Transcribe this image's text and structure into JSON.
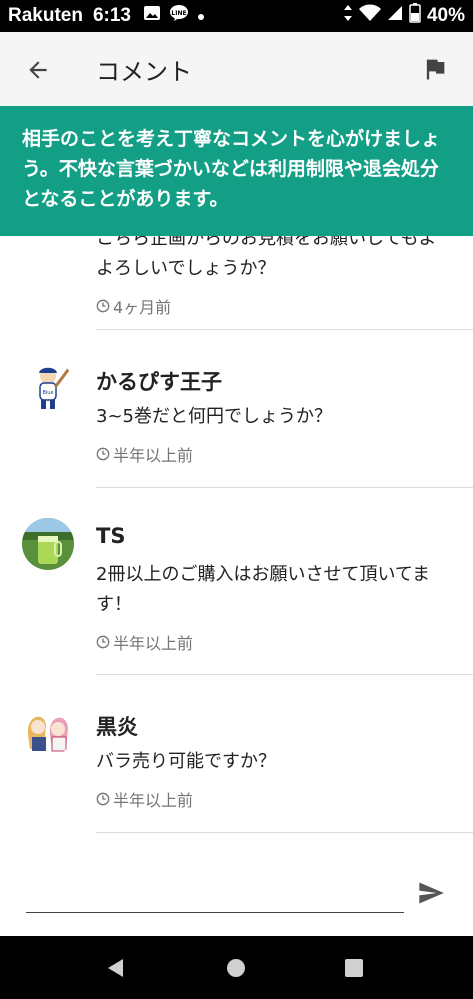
{
  "status_bar": {
    "carrier": "Rakuten",
    "time": "6:13",
    "battery": "40%",
    "icons": [
      "image-icon",
      "line-app-icon",
      "dot-icon",
      "data-arrows-icon",
      "wifi-icon",
      "signal-icon",
      "battery-icon"
    ]
  },
  "app_bar": {
    "title": "コメント",
    "back_icon": "arrow-back-icon",
    "report_icon": "flag-icon"
  },
  "banner": {
    "text": "相手のことを考え丁寧なコメントを心がけましょう。不快な言葉づかいなどは利用制限や退会処分となることがあります。"
  },
  "comments": [
    {
      "name": "",
      "text_partial_hidden": "こちら企画からのお見積をお願いしてもよ",
      "text_visible": "よろしいでしょうか？",
      "time": "4ヶ月前"
    },
    {
      "name": "かるぴす王子",
      "text": "3~5巻だと何円でしょうか？",
      "time": "半年以上前"
    },
    {
      "name": "TS",
      "text": "2冊以上のご購入はお願いさせて頂いてます！",
      "time": "半年以上前"
    },
    {
      "name": "黒炎",
      "text": "バラ売り可能ですか？",
      "time": "半年以上前"
    }
  ],
  "input": {
    "value": "",
    "placeholder": "",
    "send_icon": "send-icon"
  },
  "colors": {
    "banner": "#139f86",
    "appbar": "#f5f5f5",
    "meta_text": "#757575"
  }
}
